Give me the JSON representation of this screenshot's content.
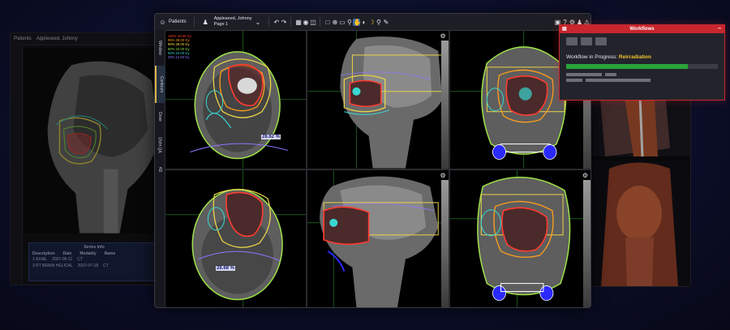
{
  "left_window": {
    "patients_label": "Patients",
    "patient_name": "Appleseed, Johnny",
    "patient_page": "Page 1",
    "tabs": [
      "Window",
      "Contours",
      "Dose",
      "DVH QA",
      "4D"
    ],
    "series_info": {
      "title": "Series Info",
      "columns": [
        "Description",
        "Date",
        "Modality",
        "Name"
      ],
      "rows": [
        [
          "1 AXIAL",
          "2007-06-11",
          "CT",
          ""
        ],
        [
          "3 RT BRAIN HELICAL",
          "2007-07-18",
          "CT",
          ""
        ]
      ]
    }
  },
  "main_window": {
    "toolbar": {
      "patients_label": "Patients",
      "patient_name": "Appleseed, Johnny",
      "patient_page": "Page 1",
      "icons": [
        "undo-icon",
        "redo-icon",
        "layout-icon",
        "camera-icon",
        "compare-icon",
        "contour-icon",
        "crosshair-icon",
        "measure-icon",
        "zoom-icon",
        "hand-icon",
        "contrast-icon",
        "banana-icon",
        "search-tool-icon",
        "annotation-icon"
      ],
      "right_icons": [
        "screenshot-icon",
        "help-icon",
        "settings-icon",
        "user-icon",
        "alert-icon"
      ]
    },
    "tabs": [
      "Window",
      "Contours",
      "Dose",
      "DVH QA",
      "4D"
    ],
    "active_tab": "Contours",
    "dose_legend": [
      {
        "label": "100% 40.00 Gy",
        "color": "#ff3b30"
      },
      {
        "label": "95% 38.00 Gy",
        "color": "#ff9f1a"
      },
      {
        "label": "90% 36.00 Gy",
        "color": "#ffe13a"
      },
      {
        "label": "80% 32.00 Gy",
        "color": "#8ee24a"
      },
      {
        "label": "50% 20.00 Gy",
        "color": "#39d7d0"
      },
      {
        "label": "30% 12.00 Gy",
        "color": "#8f74ff"
      }
    ],
    "dose_readouts": [
      "28.62 %",
      "28.68 %"
    ]
  },
  "workflow_panel": {
    "title": "Workflows",
    "status_prefix": "Workflow in Progress:",
    "status_value": "Reirradiation",
    "progress_percent": 80,
    "accent_color": "#c7272d",
    "progress_color": "#2aa43a"
  }
}
